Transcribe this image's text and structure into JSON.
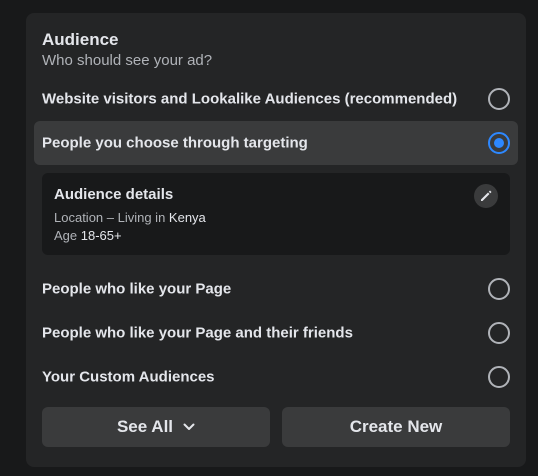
{
  "audience": {
    "title": "Audience",
    "subtitle": "Who should see your ad?"
  },
  "options": [
    {
      "label": "Website visitors and Lookalike Audiences (recommended)",
      "selected": false
    },
    {
      "label": "People you choose through targeting",
      "selected": true
    },
    {
      "label": "People who like your Page",
      "selected": false
    },
    {
      "label": "People who like your Page and their friends",
      "selected": false
    },
    {
      "label": "Your Custom Audiences",
      "selected": false
    }
  ],
  "details": {
    "title": "Audience details",
    "location_prefix": "Location – Living in ",
    "location_value": "Kenya",
    "age_prefix": "Age ",
    "age_value": "18-65+",
    "edit_icon": "pencil-icon"
  },
  "buttons": {
    "see_all": "See All",
    "see_all_icon": "chevron-down-icon",
    "create_new": "Create New"
  },
  "colors": {
    "accent": "#2d88ff",
    "card": "#242526",
    "selected_row": "#3a3b3c",
    "details_bg": "#18191a"
  }
}
